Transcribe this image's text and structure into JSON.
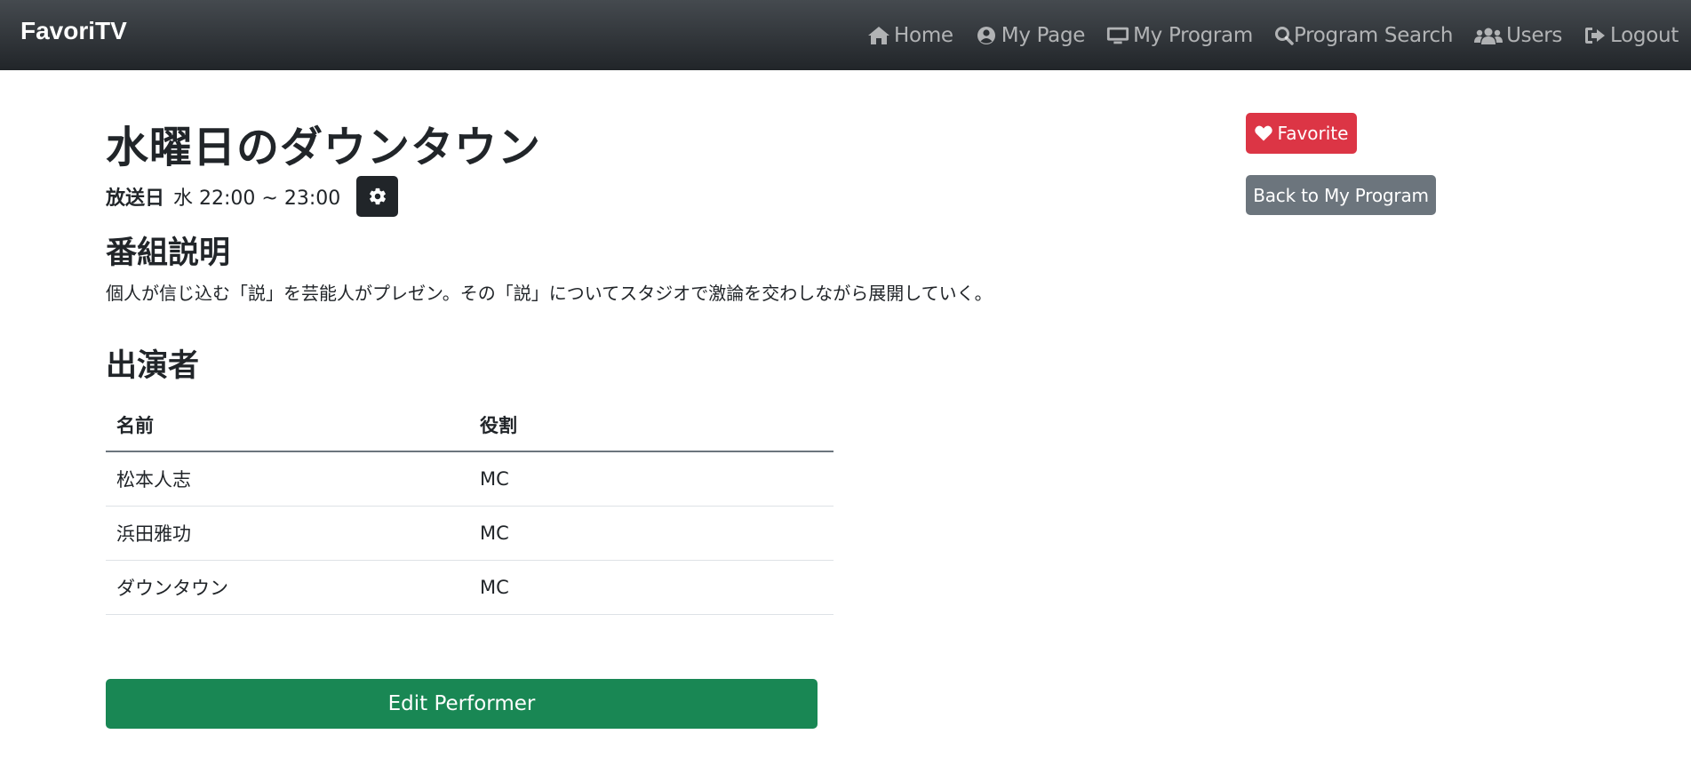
{
  "navbar": {
    "brand": "FavoriTV",
    "items": [
      {
        "label": "Home",
        "icon": "home-icon"
      },
      {
        "label": "My Page",
        "icon": "user-circle-icon"
      },
      {
        "label": "My Program",
        "icon": "tv-icon"
      },
      {
        "label": "Program Search",
        "icon": "search-icon"
      },
      {
        "label": "Users",
        "icon": "users-icon"
      },
      {
        "label": "Logout",
        "icon": "logout-icon"
      }
    ]
  },
  "program": {
    "title": "水曜日のダウンタウン",
    "broadcast_label": "放送日",
    "broadcast_value": "水 22:00 ~ 23:00",
    "description_heading": "番組説明",
    "description": "個人が信じ込む「説」を芸能人がプレゼン。その「説」についてスタジオで激論を交わしながら展開していく。",
    "performers_heading": "出演者"
  },
  "performers_table": {
    "headers": [
      "名前",
      "役割"
    ],
    "rows": [
      [
        "松本人志",
        "MC"
      ],
      [
        "浜田雅功",
        "MC"
      ],
      [
        "ダウンタウン",
        "MC"
      ]
    ]
  },
  "actions": {
    "edit_performer": "Edit Performer",
    "favorite": "Favorite",
    "back": "Back to My Program"
  },
  "colors": {
    "favorite": "#dc3545",
    "back": "#6c757d",
    "edit": "#198754",
    "navbar": "#212529"
  }
}
